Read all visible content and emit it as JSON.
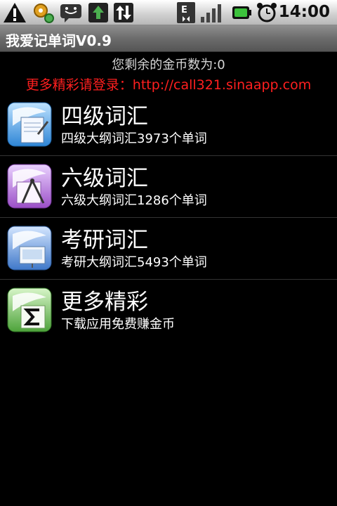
{
  "status_bar": {
    "time": "14:00",
    "icons": [
      "warning-icon",
      "settings-gear-icon",
      "chat-icon",
      "upload-icon",
      "sync-arrows-icon",
      "edge-data-icon",
      "signal-bars-icon",
      "battery-icon",
      "alarm-clock-icon"
    ],
    "network_label": "E"
  },
  "app": {
    "title": "我爱记单词V0.9"
  },
  "header": {
    "coins_text": "您剩余的金币数为:0",
    "login_text": "更多精彩请登录：http://call321.sinaapp.com"
  },
  "menu": [
    {
      "title": "四级词汇",
      "subtitle": "四级大纲词汇3973个单词",
      "icon": "document-pen-icon",
      "color": "#2f86d6"
    },
    {
      "title": "六级词汇",
      "subtitle": "六级大纲词汇1286个单词",
      "icon": "drawing-compass-icon",
      "color": "#9b4fc7"
    },
    {
      "title": "考研词汇",
      "subtitle": "考研大纲词汇5493个单词",
      "icon": "presentation-icon",
      "color": "#3f78c9"
    },
    {
      "title": "更多精彩",
      "subtitle": "下载应用免费赚金币",
      "icon": "sigma-formula-icon",
      "color": "#4da33a"
    }
  ]
}
